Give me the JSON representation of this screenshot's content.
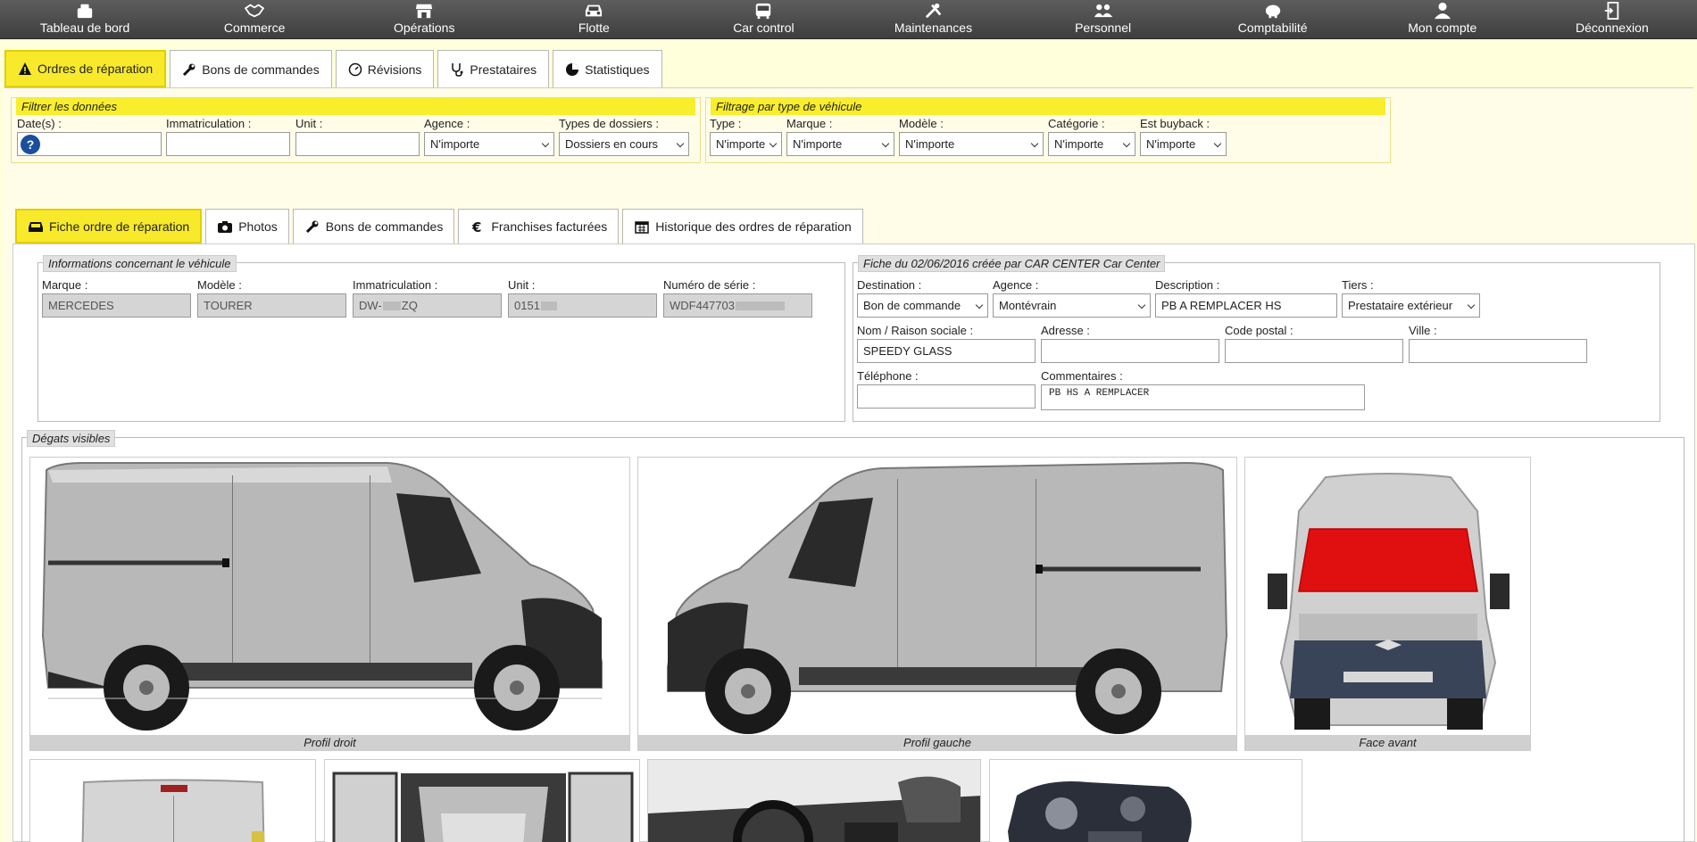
{
  "nav": [
    {
      "label": "Tableau de bord",
      "icon": "dashboard-icon"
    },
    {
      "label": "Commerce",
      "icon": "handshake-icon"
    },
    {
      "label": "Opérations",
      "icon": "store-icon"
    },
    {
      "label": "Flotte",
      "icon": "car-icon"
    },
    {
      "label": "Car control",
      "icon": "bus-icon"
    },
    {
      "label": "Maintenances",
      "icon": "tools-icon"
    },
    {
      "label": "Personnel",
      "icon": "users-icon"
    },
    {
      "label": "Comptabilité",
      "icon": "piggy-bank-icon"
    },
    {
      "label": "Mon compte",
      "icon": "user-icon"
    },
    {
      "label": "Déconnexion",
      "icon": "logout-icon"
    }
  ],
  "tabs": [
    "Ordres de réparation",
    "Bons de commandes",
    "Révisions",
    "Prestataires",
    "Statistiques"
  ],
  "filters": {
    "title": "Filtrer les données",
    "dates_label": "Date(s) :",
    "help": "?",
    "immat_label": "Immatriculation :",
    "unit_label": "Unit :",
    "agence_label": "Agence :",
    "agence_value": "N'importe",
    "types_label": "Types de dossiers :",
    "types_value": "Dossiers en cours"
  },
  "vehicle_filter": {
    "title": "Filtrage par type de véhicule",
    "type_label": "Type :",
    "type_value": "N'importe",
    "marque_label": "Marque :",
    "marque_value": "N'importe",
    "modele_label": "Modèle :",
    "modele_value": "N'importe",
    "categorie_label": "Catégorie :",
    "categorie_value": "N'importe",
    "buyback_label": "Est buyback :",
    "buyback_value": "N'importe"
  },
  "subtabs": [
    "Fiche ordre de réparation",
    "Photos",
    "Bons de commandes",
    "Franchises facturées",
    "Historique des ordres de réparation"
  ],
  "vehicle_info": {
    "title": "Informations concernant le véhicule",
    "marque_label": "Marque :",
    "marque": "MERCEDES",
    "modele_label": "Modèle :",
    "modele": "TOURER",
    "immat_label": "Immatriculation :",
    "immat_prefix": "DW-",
    "immat_suffix": "ZQ",
    "unit_label": "Unit :",
    "unit": "0151",
    "serie_label": "Numéro de série :",
    "serie": "WDF447703"
  },
  "fiche": {
    "title": "Fiche du 02/06/2016 créée par CAR CENTER Car Center",
    "destination_label": "Destination :",
    "destination": "Bon de commande",
    "agence_label": "Agence :",
    "agence": "Montévrain",
    "description_label": "Description :",
    "description": "PB A REMPLACER HS",
    "tiers_label": "Tiers :",
    "tiers": "Prestataire extérieur",
    "nom_label": "Nom / Raison sociale :",
    "nom": "SPEEDY GLASS",
    "adresse_label": "Adresse :",
    "adresse": "",
    "cp_label": "Code postal :",
    "cp": "",
    "ville_label": "Ville :",
    "ville": "",
    "tel_label": "Téléphone :",
    "tel": "",
    "comment_label": "Commentaires :",
    "comment": "PB HS A REMPLACER"
  },
  "degats": {
    "title": "Dégats visibles",
    "captions": [
      "Profil droit",
      "Profil gauche",
      "Face avant"
    ]
  },
  "colors": {
    "accent": "#f8ea2a",
    "damage": "#e01010",
    "nav": "#4a4a4a"
  }
}
